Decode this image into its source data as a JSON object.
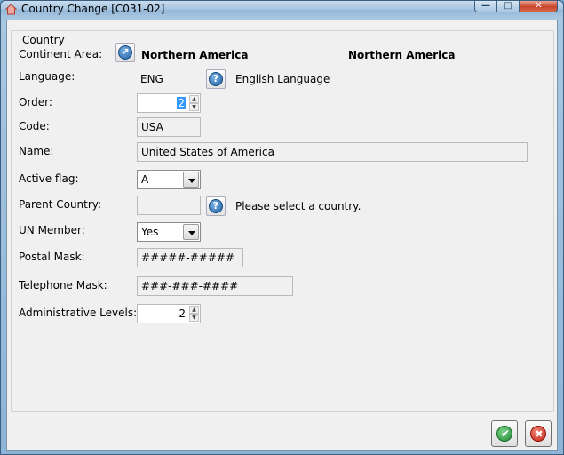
{
  "window": {
    "title": "Country Change [C031-02]",
    "controls": {
      "minimize": "—",
      "maximize": "□",
      "close": "✕"
    }
  },
  "group": {
    "caption": "Country"
  },
  "fields": {
    "continent_area": {
      "label": "Continent Area:",
      "value": "Northern America",
      "description": "Northern America",
      "icon": "navigate-arrow-icon"
    },
    "language": {
      "label": "Language:",
      "value": "ENG",
      "description": "English Language",
      "icon": "help-lookup-icon"
    },
    "order": {
      "label": "Order:",
      "value": "2"
    },
    "code": {
      "label": "Code:",
      "value": "USA"
    },
    "name": {
      "label": "Name:",
      "value": "United States of America"
    },
    "active_flag": {
      "label": "Active flag:",
      "value": "A"
    },
    "parent_country": {
      "label": "Parent Country:",
      "value": "",
      "description": "Please select a country.",
      "icon": "help-lookup-icon"
    },
    "un_member": {
      "label": "UN Member:",
      "value": "Yes"
    },
    "postal_mask": {
      "label": "Postal Mask:",
      "value": "#####-#####"
    },
    "telephone_mask": {
      "label": "Telephone Mask:",
      "value": "###-###-####"
    },
    "administrative_levels": {
      "label": "Administrative Levels:",
      "value": "2"
    }
  },
  "buttons": {
    "ok": {
      "icon": "checkmark-icon",
      "color": "#1e8a33"
    },
    "cancel": {
      "icon": "cancel-x-icon",
      "color": "#c31f12"
    }
  },
  "colors": {
    "titlebar": "#a4c3df",
    "dialog_background": "#f0f0f0",
    "selection": "#3399ff"
  }
}
